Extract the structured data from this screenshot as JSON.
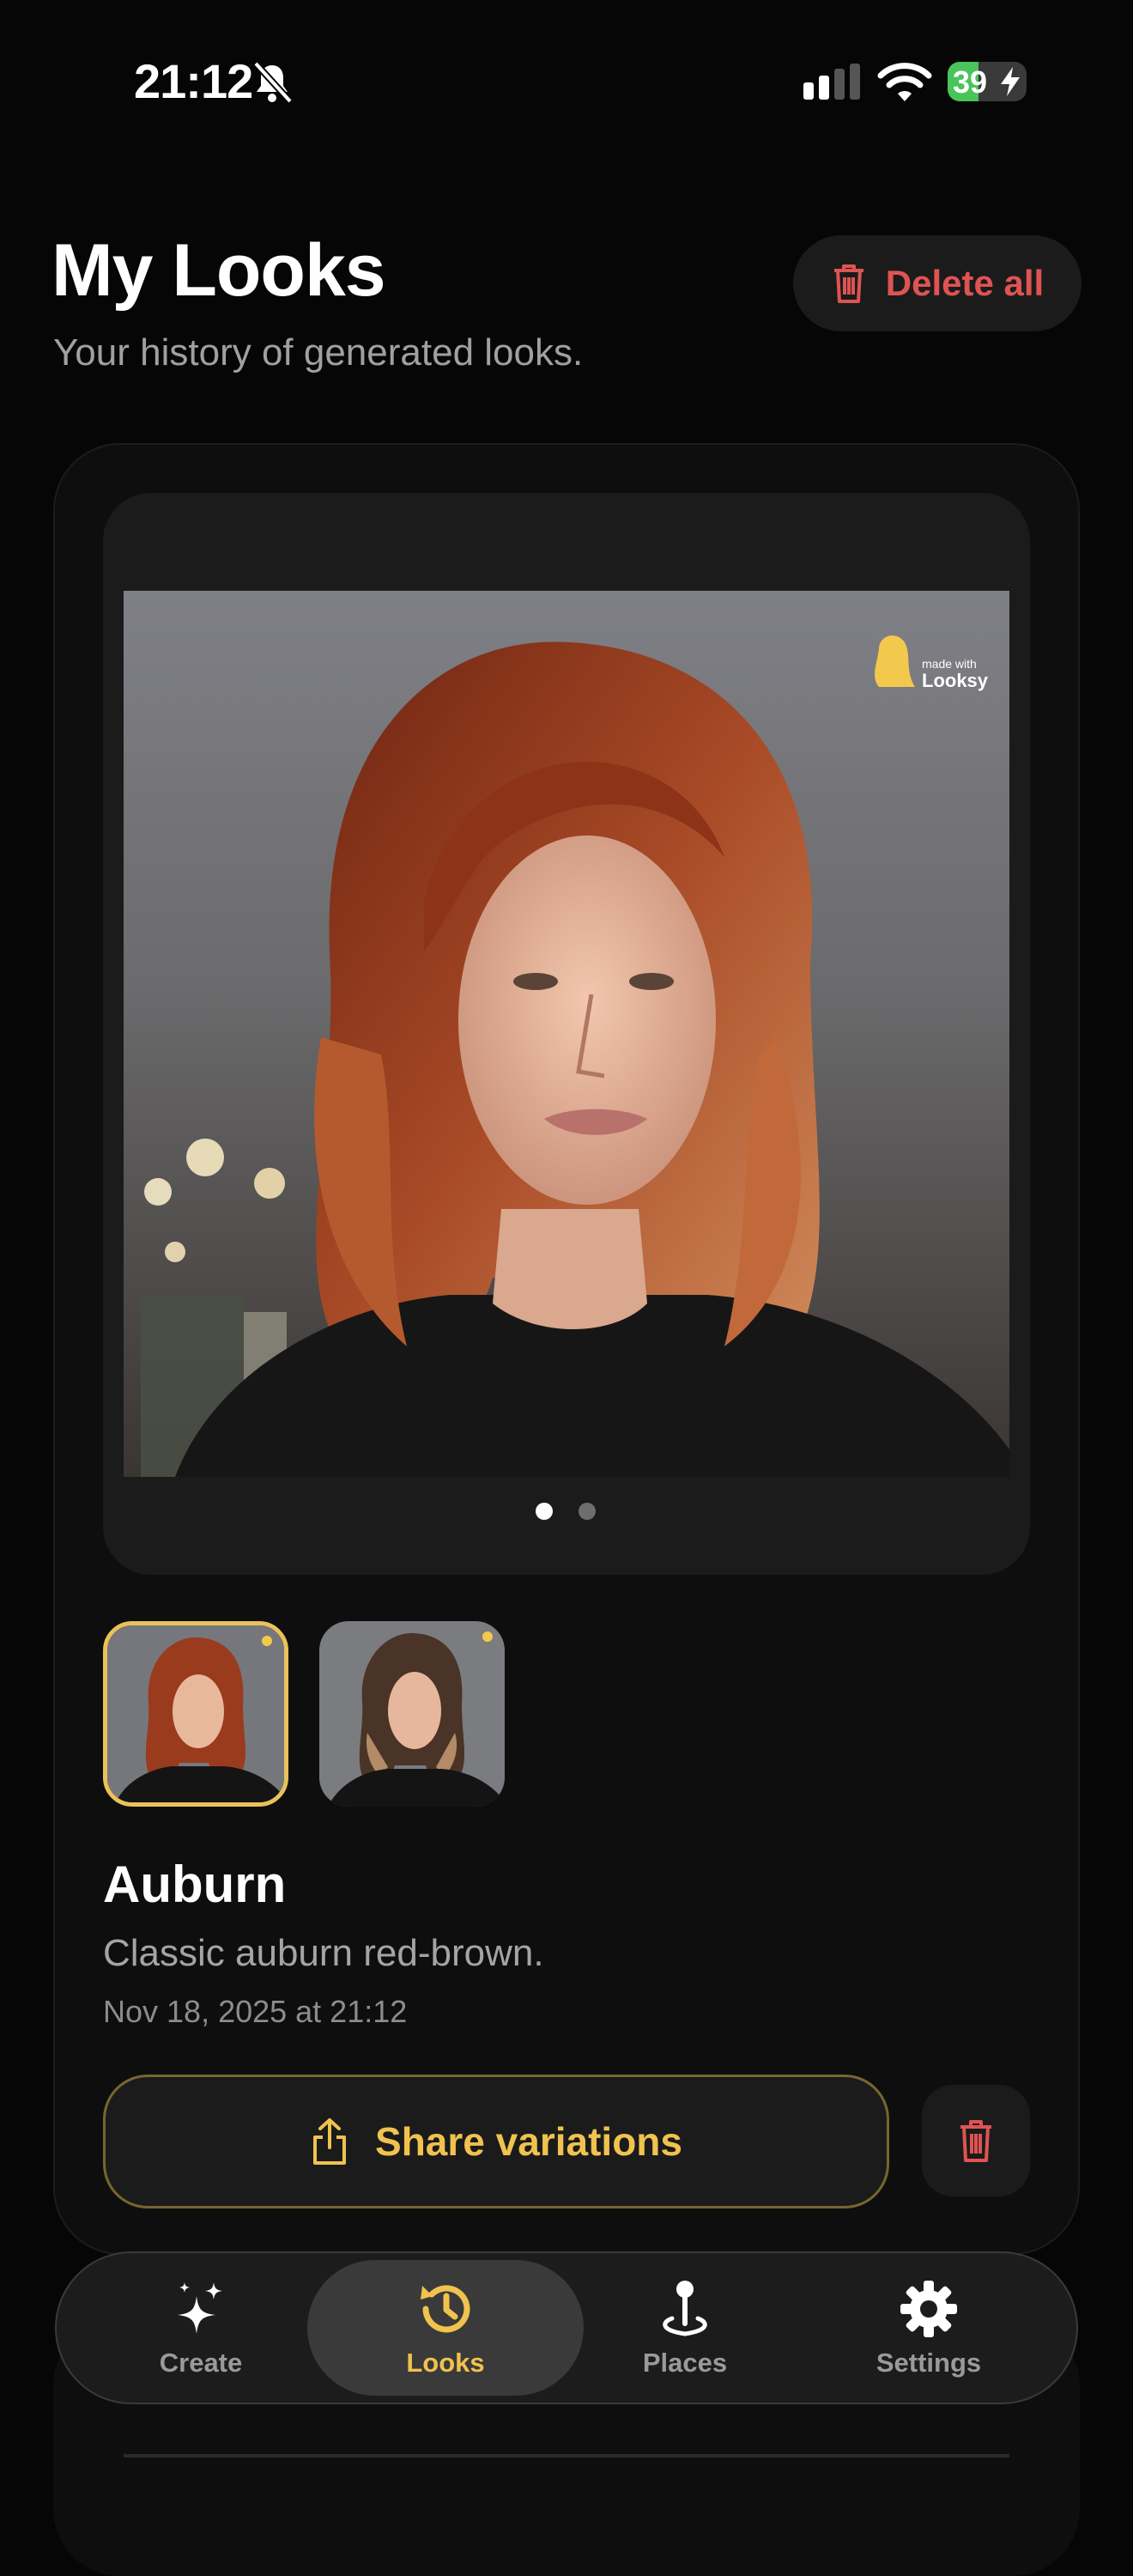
{
  "status_bar": {
    "time": "21:12",
    "battery": "39",
    "battery_level": 0.39,
    "icons": [
      "bell-off-icon",
      "signal-icon",
      "wifi-icon",
      "battery-charging-icon"
    ]
  },
  "header": {
    "title": "My Looks",
    "subtitle": "Your history of generated looks.",
    "delete_all_label": "Delete all"
  },
  "look": {
    "name": "Auburn",
    "description": "Classic auburn red-brown.",
    "date": "Nov 18, 2025 at 21:12",
    "watermark": "made with Looksy",
    "carousel": {
      "pages": 2,
      "current": 1
    },
    "thumbnails": [
      {
        "hair_color": "#9a3b1e",
        "selected": true
      },
      {
        "hair_color": "#4a3327",
        "selected": false
      }
    ],
    "share_label": "Share variations"
  },
  "tabs": [
    {
      "label": "Create",
      "icon": "sparkles-icon",
      "active": false
    },
    {
      "label": "Looks",
      "icon": "history-icon",
      "active": true
    },
    {
      "label": "Places",
      "icon": "map-pin-icon",
      "active": false
    },
    {
      "label": "Settings",
      "icon": "gear-icon",
      "active": false
    }
  ],
  "colors": {
    "accent": "#f0c24e",
    "danger": "#e05353",
    "background": "#060606",
    "card": "#0e0e0e"
  }
}
